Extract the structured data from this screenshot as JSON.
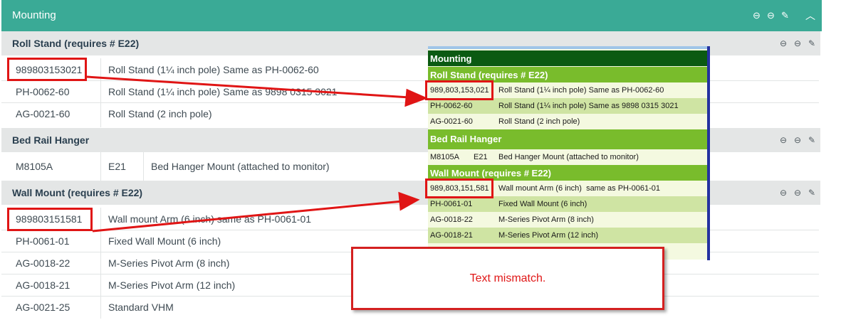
{
  "header": {
    "title": "Mounting",
    "icons": [
      "minus-circle-icon",
      "minus-circle-icon",
      "edit-icon",
      "chevron-up-icon"
    ]
  },
  "sections": [
    {
      "title": "Roll Stand (requires # E22)",
      "rows": [
        {
          "code": "989803153021",
          "desc": "Roll Stand (1¼ inch pole) Same as PH-0062-60"
        },
        {
          "code": "PH-0062-60",
          "desc": "Roll Stand (1¼ inch pole) Same as 9898 0315 3021"
        },
        {
          "code": "AG-0021-60",
          "desc": "Roll Stand (2 inch pole)"
        }
      ]
    },
    {
      "title": "Bed Rail Hanger",
      "rows": [
        {
          "code": "M8105A",
          "ref": "E21",
          "desc": "Bed Hanger Mount (attached to monitor)"
        }
      ]
    },
    {
      "title": "Wall Mount (requires # E22)",
      "rows": [
        {
          "code": "989803151581",
          "desc": "Wall mount Arm (6 inch) same as PH-0061-01"
        },
        {
          "code": "PH-0061-01",
          "desc": "Fixed Wall Mount (6 inch)"
        },
        {
          "code": "AG-0018-22",
          "desc": "M-Series Pivot Arm (8 inch)"
        },
        {
          "code": "AG-0018-21",
          "desc": "M-Series Pivot Arm (12 inch)"
        },
        {
          "code": "AG-0021-25",
          "desc": "Standard VHM"
        }
      ]
    }
  ],
  "overlay": {
    "title": "Mounting",
    "sections": [
      {
        "title": "Roll Stand (requires # E22)",
        "rows": [
          {
            "code": "989,803,153,021",
            "desc": "Roll Stand (1¼ inch pole) Same as PH-0062-60"
          },
          {
            "code": "PH-0062-60",
            "desc": "Roll Stand (1¼ inch pole) Same as 9898 0315 3021"
          },
          {
            "code": "AG-0021-60",
            "desc": "Roll Stand (2 inch pole)"
          }
        ]
      },
      {
        "title": "Bed Rail Hanger",
        "rows": [
          {
            "code": "M8105A",
            "ref": "E21",
            "desc": "Bed Hanger Mount (attached to monitor)"
          }
        ]
      },
      {
        "title": "Wall Mount (requires # E22)",
        "rows": [
          {
            "code": "989,803,151,581",
            "desc": "Wall mount Arm (6 inch)  same as PH-0061-01"
          },
          {
            "code": "PH-0061-01",
            "desc": "Fixed Wall Mount (6 inch)"
          },
          {
            "code": "AG-0018-22",
            "desc": "M-Series Pivot Arm (8 inch)"
          },
          {
            "code": "AG-0018-21",
            "desc": "M-Series Pivot Arm (12 inch)"
          }
        ]
      }
    ]
  },
  "annotation": {
    "text": "Text mismatch."
  },
  "colors": {
    "header_teal": "#3aaa96",
    "section_bg": "#e4e6e6",
    "overlay_dark_green": "#0b5a12",
    "overlay_light_green": "#79bc2c",
    "annotation_red": "#e01515"
  }
}
